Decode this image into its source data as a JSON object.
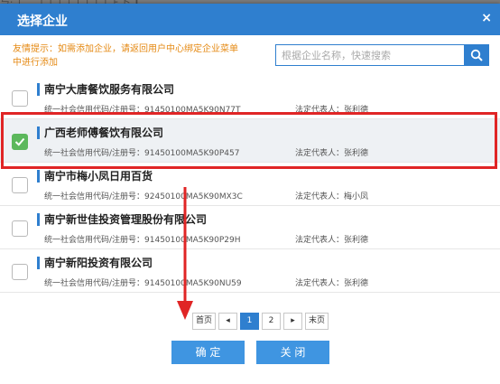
{
  "background": {
    "text": "ㄣ⋅ │ 二 │ │ │ │ │ │ │ │ ├ 卜 ┃"
  },
  "dialog": {
    "title": "选择企业",
    "close_glyph": "×"
  },
  "tip": {
    "text": "友情提示：如需添加企业，请返回用户中心绑定企业菜单中进行添加"
  },
  "search": {
    "placeholder": "根据企业名称，快速搜索",
    "value": "",
    "icon": "search-icon"
  },
  "companies": [
    {
      "name": "南宁大唐餐饮服务有限公司",
      "code": "统一社会信用代码/注册号：91450100MA5K90N77T",
      "rep": "法定代表人：张利德",
      "selected": false
    },
    {
      "name": "广西老师傅餐饮有限公司",
      "code": "统一社会信用代码/注册号：91450100MA5K90P457",
      "rep": "法定代表人：张利德",
      "selected": true
    },
    {
      "name": "南宁市梅小凤日用百货",
      "code": "统一社会信用代码/注册号：92450100MA5K90MX3C",
      "rep": "法定代表人：梅小凤",
      "selected": false
    },
    {
      "name": "南宁新世佳投资管理股份有限公司",
      "code": "统一社会信用代码/注册号：91450100MA5K90P29H",
      "rep": "法定代表人：张利德",
      "selected": false
    },
    {
      "name": "南宁新阳投资有限公司",
      "code": "统一社会信用代码/注册号：91450100MA5K90NU59",
      "rep": "法定代表人：张利德",
      "selected": false
    }
  ],
  "pagination": {
    "first": "首页",
    "prev": "◂",
    "pages": [
      "1",
      "2"
    ],
    "current": "1",
    "next": "▸",
    "last": "末页"
  },
  "buttons": {
    "confirm": "确 定",
    "close": "关 闭"
  },
  "colors": {
    "primary": "#2f7fcf",
    "annotation": "#e02525",
    "tip": "#e58a14",
    "checked": "#5cb85c"
  }
}
